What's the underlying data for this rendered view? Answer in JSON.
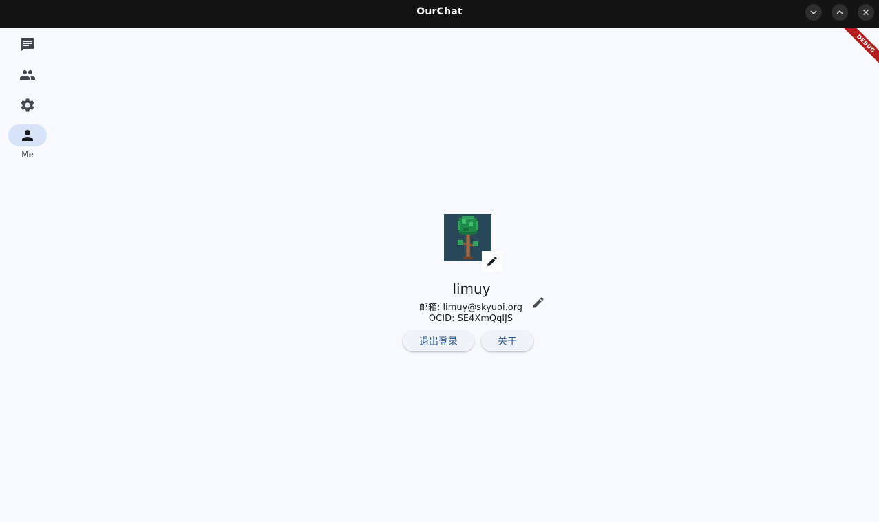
{
  "window": {
    "title": "OurChat",
    "controls": [
      "minimize",
      "maximize",
      "close"
    ]
  },
  "rail": {
    "items": [
      {
        "icon": "chat-icon",
        "label": ""
      },
      {
        "icon": "people-icon",
        "label": ""
      },
      {
        "icon": "gear-icon",
        "label": ""
      },
      {
        "icon": "person-icon",
        "label": "Me",
        "active": true
      }
    ]
  },
  "debug_banner": "DEBUG",
  "profile": {
    "username": "limuy",
    "email": "邮箱: limuy@skyuoi.org",
    "ocid": "OCID: SE4XmQqlJS"
  },
  "actions": {
    "logout_label": "退出登录",
    "about_label": "关于"
  },
  "colors": {
    "titlebar": "#141414",
    "background": "#f8f9ff",
    "rail_active": "#d7e3f8",
    "button_text": "#2c5a91",
    "debug_ribbon": "#b71c1c"
  }
}
